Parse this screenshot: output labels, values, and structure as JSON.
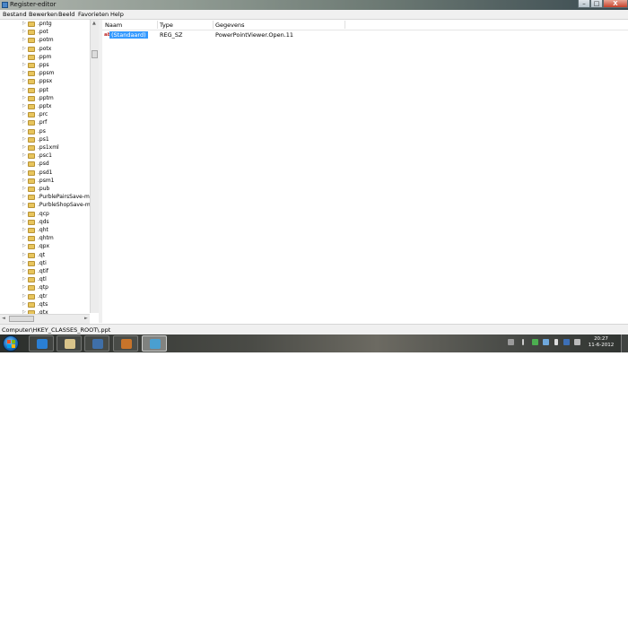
{
  "window": {
    "title": "Register-editor",
    "minimize_glyph": "–",
    "maximize_glyph": "□",
    "close_glyph": "X"
  },
  "menu": [
    "Bestand",
    "Bewerken",
    "Beeld",
    "Favorieten",
    "Help"
  ],
  "tree": {
    "items": [
      ".pntg",
      ".pot",
      ".potm",
      ".potx",
      ".ppm",
      ".pps",
      ".ppsm",
      ".ppsx",
      ".ppt",
      ".pptm",
      ".pptx",
      ".prc",
      ".prf",
      ".ps",
      ".ps1",
      ".ps1xml",
      ".psc1",
      ".psd",
      ".psd1",
      ".psm1",
      ".pub",
      ".PurblePairsSave-ms",
      ".PurbleShopSave-ms",
      ".qcp",
      ".qds",
      ".qht",
      ".qhtm",
      ".qpx",
      ".qt",
      ".qti",
      ".qtif",
      ".qtl",
      ".qtp",
      ".qtr",
      ".qts",
      ".qtx"
    ]
  },
  "list": {
    "columns": [
      "Naam",
      "Type",
      "Gegevens"
    ],
    "rows": [
      {
        "icon": "string-value-icon",
        "name": "(Standaard)",
        "type": "REG_SZ",
        "data": "PowerPointViewer.Open.11"
      }
    ]
  },
  "status": {
    "path": "Computer\\HKEY_CLASSES_ROOT\\.ppt"
  },
  "taskbar": {
    "buttons": [
      {
        "name": "internet-explorer-icon",
        "color": "#2a7fd4"
      },
      {
        "name": "explorer-folder-icon",
        "color": "#d9c48a"
      },
      {
        "name": "thunderbird-icon",
        "color": "#3f6fa8"
      },
      {
        "name": "app-icon",
        "color": "#c8742a"
      },
      {
        "name": "regedit-icon",
        "color": "#4a9fd0"
      }
    ],
    "clock": {
      "time": "20:27",
      "date": "11-6-2012"
    }
  }
}
